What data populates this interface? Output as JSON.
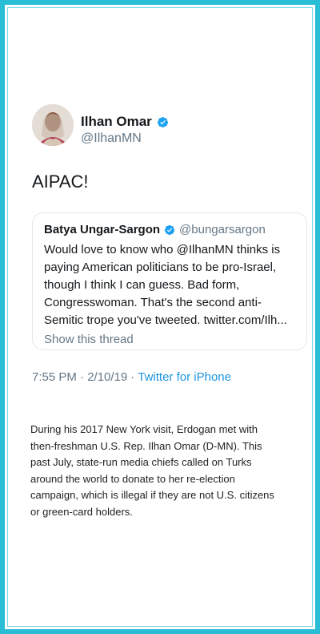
{
  "tweet": {
    "author_name": "Ilhan Omar",
    "author_handle": "@IlhanMN",
    "text": "AIPAC!",
    "timestamp": "7:55 PM · 2/10/19",
    "separator": "·",
    "source": "Twitter for iPhone",
    "verified_icon": "verified-badge-icon"
  },
  "quoted_tweet": {
    "author_name": "Batya Ungar-Sargon",
    "author_handle": "@bungarsargon",
    "text": "Would love to know who @IlhanMN thinks is\npaying American politicians to be pro-Israel,\nthough I think I can guess. Bad form,\nCongresswoman. That's the second anti-\nSemitic trope you've tweeted. twitter.com/Ilh...",
    "show_thread_label": "Show this thread"
  },
  "article": {
    "paragraph": "During his 2017 New York visit, Erdogan met with\nthen-freshman U.S. Rep. Ilhan Omar (D-MN). This\npast July, state-run media chiefs called on Turks\naround the world to donate to her re-election\ncampaign, which is illegal if they are not U.S. citizens\nor green-card holders."
  },
  "colors": {
    "frame": "#2bbcd6",
    "verified": "#1da1f2",
    "link": "#1b95e0",
    "muted": "#657786"
  }
}
